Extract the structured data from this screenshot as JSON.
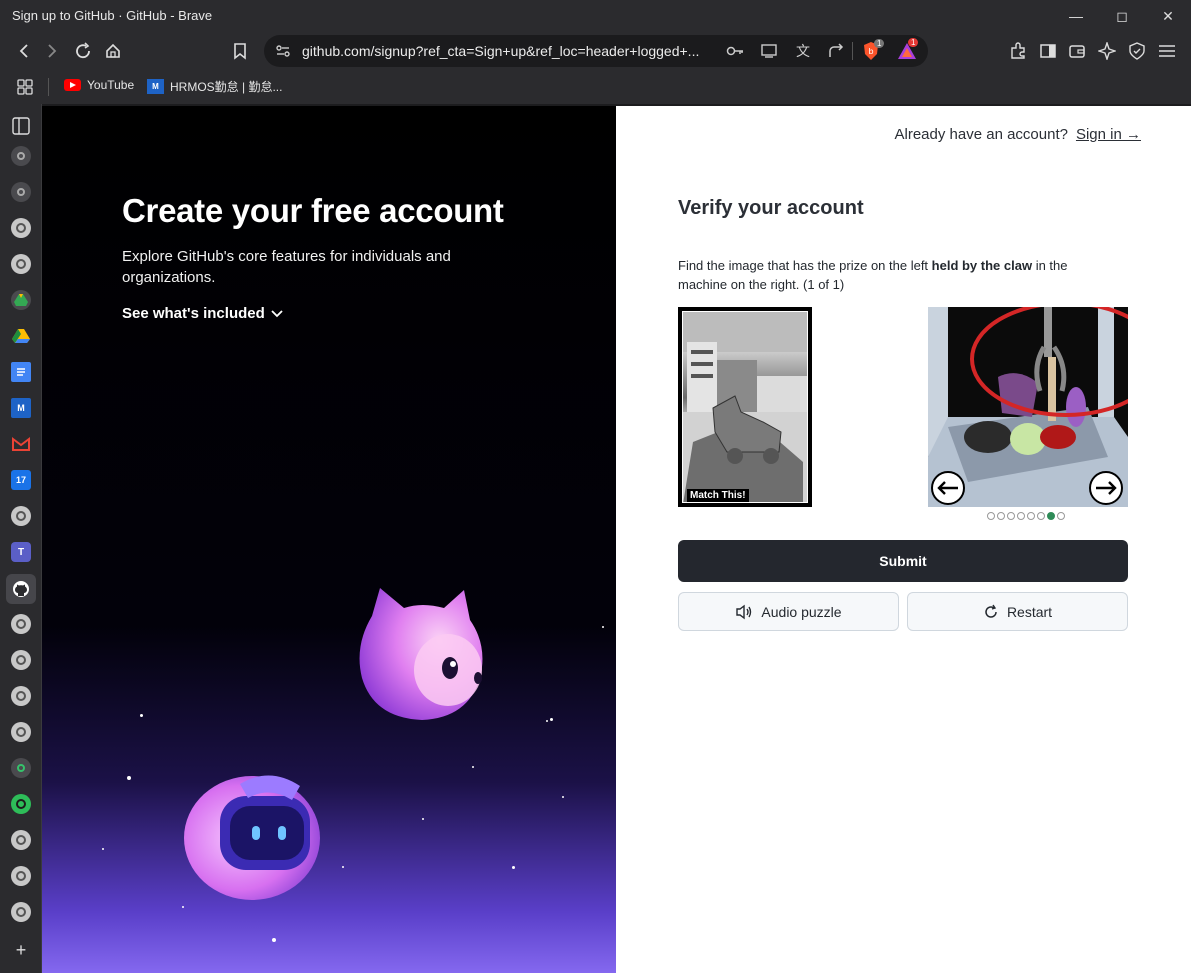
{
  "window": {
    "title": "Sign up to GitHub · GitHub - Brave"
  },
  "toolbar": {
    "url": "github.com/signup?ref_cta=Sign+up&ref_loc=header+logged+..."
  },
  "bookmarks": [
    {
      "label": "YouTube",
      "icon": "youtube-icon"
    },
    {
      "label": "HRMOS勤怠 | 勤怠...",
      "icon": "hrmos-icon"
    }
  ],
  "badges": {
    "brave_shields": "1",
    "rewards": "1"
  },
  "left": {
    "heading": "Create your free account",
    "subtitle": "Explore GitHub's core features for individuals and organizations.",
    "see_included": "See what's included"
  },
  "right": {
    "have_account": "Already have an account?",
    "sign_in": "Sign in →",
    "heading": "Verify your account",
    "instruction_pre": "Find the image that has the prize on the left ",
    "instruction_bold": "held by the claw",
    "instruction_post": " in the machine on the right. (1 of 1)",
    "match_label": "Match This!",
    "submit": "Submit",
    "audio": "Audio puzzle",
    "restart": "Restart",
    "carousel": {
      "total": 8,
      "active": 7
    }
  },
  "colors": {
    "accent": "#2e8b57",
    "submit_bg": "#24272e",
    "annotation": "#d42626"
  }
}
